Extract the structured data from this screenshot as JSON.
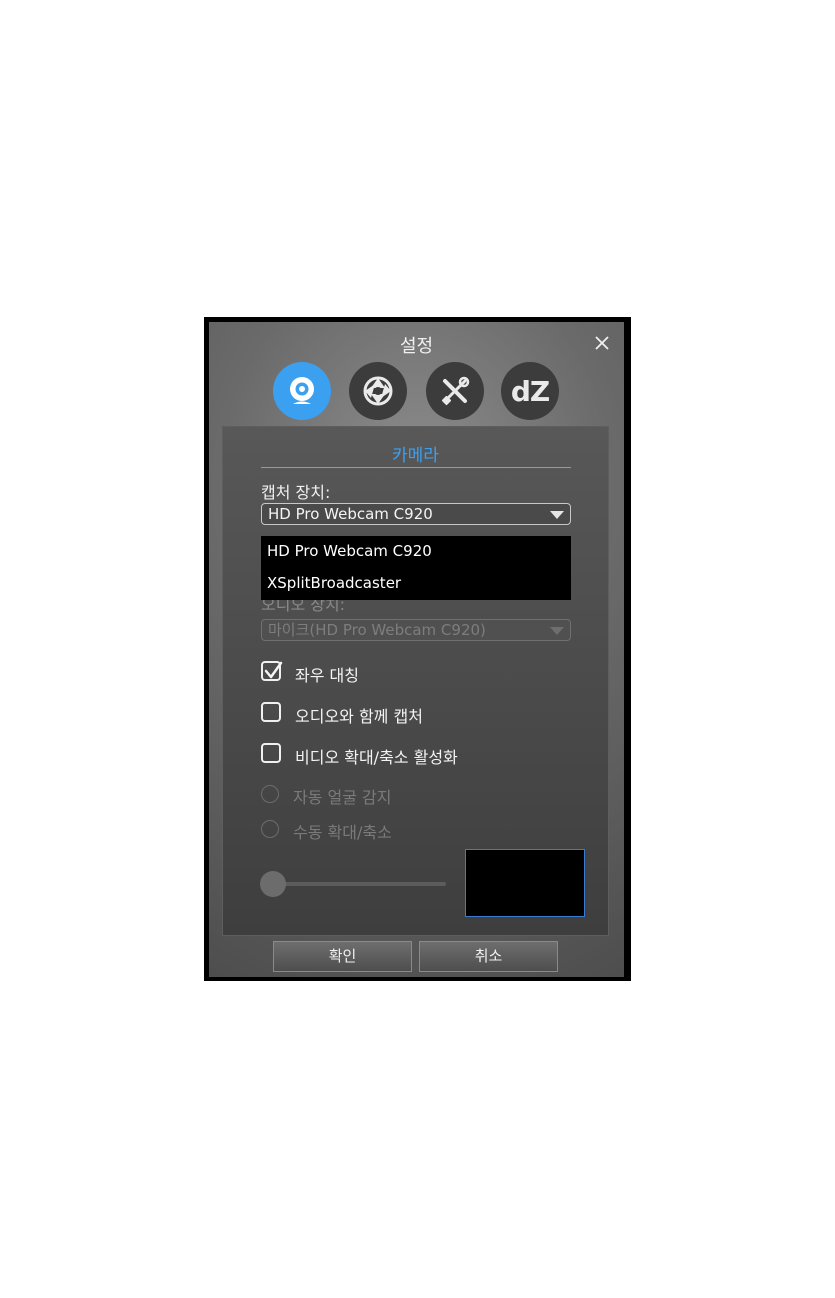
{
  "dialog": {
    "title": "설정",
    "tabs": [
      {
        "icon": "webcam-icon",
        "active": true
      },
      {
        "icon": "aperture-icon",
        "active": false
      },
      {
        "icon": "tools-icon",
        "active": false
      },
      {
        "icon": "dz-logo-icon",
        "label": "dZ",
        "active": false
      }
    ]
  },
  "camera": {
    "section_title": "카메라",
    "capture_device_label": "캡처 장치:",
    "capture_device_value": "HD Pro Webcam C920",
    "dropdown_options": [
      "HD Pro Webcam C920",
      "XSplitBroadcaster"
    ],
    "audio_device_label": "오디오 장치:",
    "audio_device_value": "마이크(HD Pro Webcam C920)",
    "options": [
      {
        "label": "좌우 대칭",
        "checked": true
      },
      {
        "label": "오디오와 함께 캡처",
        "checked": false
      },
      {
        "label": "비디오 확대/축소 활성화",
        "checked": false
      }
    ],
    "radios": [
      {
        "label": "자동 얼굴 감지"
      },
      {
        "label": "수동 확대/축소"
      }
    ],
    "zoom_level": 0
  },
  "footer": {
    "ok_label": "확인",
    "cancel_label": "취소"
  },
  "colors": {
    "accent": "#3ca0f0",
    "preview_border": "#3a7ccf"
  }
}
